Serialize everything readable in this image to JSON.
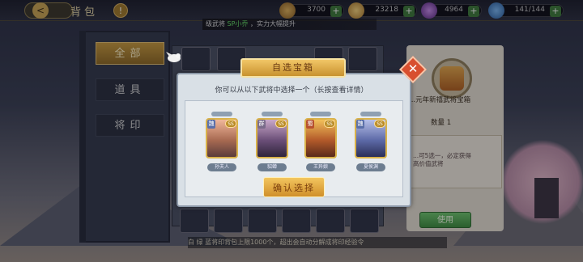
{
  "header": {
    "title": "背包",
    "info_label": "!",
    "back_label": "<",
    "resources": [
      {
        "icon": "copper-coin-icon",
        "value": "3700"
      },
      {
        "icon": "gold-ingot-icon",
        "value": "23218"
      },
      {
        "icon": "purple-gem-icon",
        "value": "4964"
      },
      {
        "icon": "stamina-bolt-icon",
        "value": "141/144"
      }
    ]
  },
  "banner": {
    "prefix": "级武将",
    "highlight": "SP小乔",
    "suffix": "，实力大幅提升"
  },
  "sidebar": {
    "tabs": [
      {
        "label": "全部",
        "active": true
      },
      {
        "label": "道具",
        "active": false
      },
      {
        "label": "将印",
        "active": false
      }
    ]
  },
  "detail_panel": {
    "title": "...元年新禧武将宝箱",
    "quantity": "数量 1",
    "description": "...可5选一，必定获得高价值武将",
    "use_label": "使用"
  },
  "footer": {
    "text": "白  绿  蓝将印背包上限1000个，超出会自动分解成将印经验令"
  },
  "dialog": {
    "title": "自选宝箱",
    "subtitle": "你可以从以下武将中选择一个（长按查看详情）",
    "close_label": "✕",
    "confirm_label": "确认选择",
    "heroes": [
      {
        "badge": "魏",
        "rank": "SS",
        "name": "孙夫人",
        "badge_color": "#5a6fa8"
      },
      {
        "badge": "群",
        "rank": "SS",
        "name": "貂蝉",
        "badge_color": "#7a6b8a"
      },
      {
        "badge": "蜀",
        "rank": "SS",
        "name": "王异娘",
        "badge_color": "#b7502e"
      },
      {
        "badge": "魏",
        "rank": "SS",
        "name": "夏侯渊",
        "badge_color": "#5a6fa8"
      }
    ]
  },
  "colors": {
    "accent_gold": "#c79a3e",
    "use_green": "#4f9e4c",
    "close_red": "#d84f2f"
  }
}
